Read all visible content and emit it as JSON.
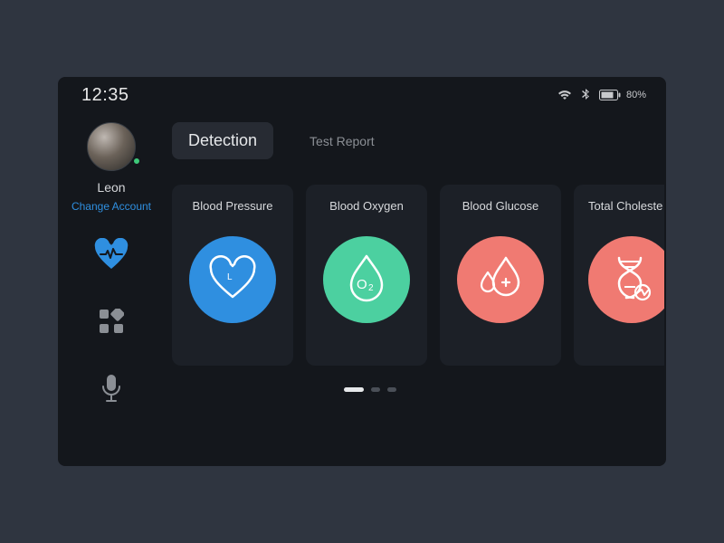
{
  "status": {
    "time": "12:35",
    "battery_pct": "80%"
  },
  "user": {
    "name": "Leon",
    "change_account": "Change Account"
  },
  "tabs": {
    "detection": "Detection",
    "test_report": "Test Report"
  },
  "cards": [
    {
      "title": "Blood Pressure",
      "color": "#2f8fe0",
      "icon": "heart"
    },
    {
      "title": "Blood Oxygen",
      "color": "#4cd0a0",
      "icon": "oxygen"
    },
    {
      "title": "Blood Glucose",
      "color": "#f07a72",
      "icon": "glucose"
    },
    {
      "title": "Total Choleste",
      "color": "#f07a72",
      "icon": "dna"
    }
  ],
  "pager": {
    "active_index": 0,
    "count": 3
  }
}
